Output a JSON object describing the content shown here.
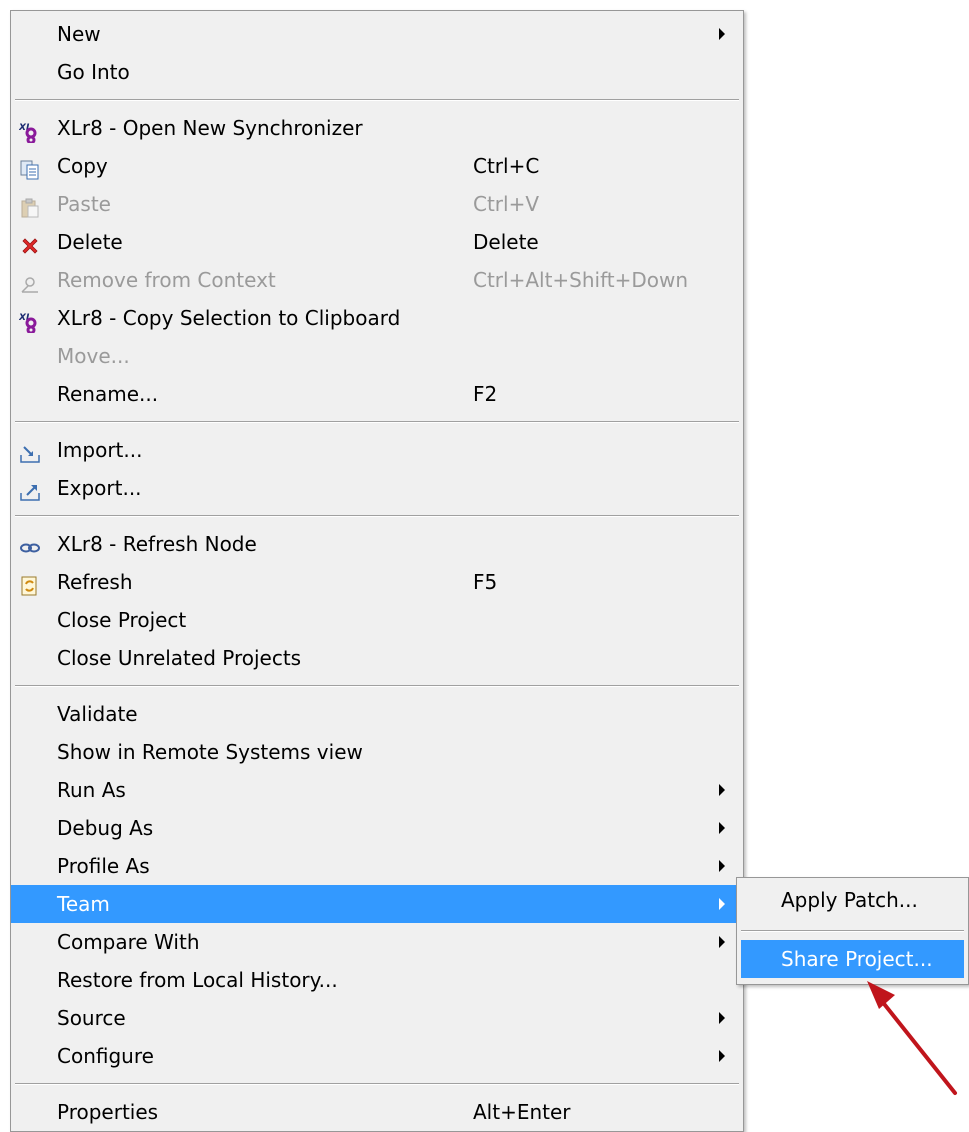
{
  "menu": {
    "items": [
      {
        "type": "item",
        "name": "menu-item-new",
        "label": "New",
        "submenu": true
      },
      {
        "type": "item",
        "name": "menu-item-go-into",
        "label": "Go Into"
      },
      {
        "type": "separator"
      },
      {
        "type": "item",
        "name": "menu-item-xlr8-open-new-synchronizer",
        "label": "XLr8 - Open New Synchronizer",
        "icon": "xlr8-icon"
      },
      {
        "type": "item",
        "name": "menu-item-copy",
        "label": "Copy",
        "shortcut": "Ctrl+C",
        "icon": "copy-icon"
      },
      {
        "type": "item",
        "name": "menu-item-paste",
        "label": "Paste",
        "shortcut": "Ctrl+V",
        "icon": "paste-icon",
        "disabled": true
      },
      {
        "type": "item",
        "name": "menu-item-delete",
        "label": "Delete",
        "shortcut": "Delete",
        "icon": "delete-icon"
      },
      {
        "type": "item",
        "name": "menu-item-remove-from-context",
        "label": "Remove from Context",
        "shortcut": "Ctrl+Alt+Shift+Down",
        "icon": "remove-context-icon",
        "disabled": true
      },
      {
        "type": "item",
        "name": "menu-item-xlr8-copy-selection",
        "label": "XLr8 - Copy Selection to Clipboard",
        "icon": "xlr8-icon"
      },
      {
        "type": "item",
        "name": "menu-item-move",
        "label": "Move...",
        "disabled": true
      },
      {
        "type": "item",
        "name": "menu-item-rename",
        "label": "Rename...",
        "shortcut": "F2"
      },
      {
        "type": "separator"
      },
      {
        "type": "item",
        "name": "menu-item-import",
        "label": "Import...",
        "icon": "import-icon"
      },
      {
        "type": "item",
        "name": "menu-item-export",
        "label": "Export...",
        "icon": "export-icon"
      },
      {
        "type": "separator"
      },
      {
        "type": "item",
        "name": "menu-item-xlr8-refresh-node",
        "label": "XLr8 - Refresh Node",
        "icon": "link-icon"
      },
      {
        "type": "item",
        "name": "menu-item-refresh",
        "label": "Refresh",
        "shortcut": "F5",
        "icon": "refresh-icon"
      },
      {
        "type": "item",
        "name": "menu-item-close-project",
        "label": "Close Project"
      },
      {
        "type": "item",
        "name": "menu-item-close-unrelated-projects",
        "label": "Close Unrelated Projects"
      },
      {
        "type": "separator"
      },
      {
        "type": "item",
        "name": "menu-item-validate",
        "label": "Validate"
      },
      {
        "type": "item",
        "name": "menu-item-show-in-remote-systems",
        "label": "Show in Remote Systems view"
      },
      {
        "type": "item",
        "name": "menu-item-run-as",
        "label": "Run As",
        "submenu": true
      },
      {
        "type": "item",
        "name": "menu-item-debug-as",
        "label": "Debug As",
        "submenu": true
      },
      {
        "type": "item",
        "name": "menu-item-profile-as",
        "label": "Profile As",
        "submenu": true
      },
      {
        "type": "item",
        "name": "menu-item-team",
        "label": "Team",
        "submenu": true,
        "highlighted": true
      },
      {
        "type": "item",
        "name": "menu-item-compare-with",
        "label": "Compare With",
        "submenu": true
      },
      {
        "type": "item",
        "name": "menu-item-restore-from-local-history",
        "label": "Restore from Local History..."
      },
      {
        "type": "item",
        "name": "menu-item-source",
        "label": "Source",
        "submenu": true
      },
      {
        "type": "item",
        "name": "menu-item-configure",
        "label": "Configure",
        "submenu": true
      },
      {
        "type": "separator"
      },
      {
        "type": "item",
        "name": "menu-item-properties",
        "label": "Properties",
        "shortcut": "Alt+Enter"
      }
    ]
  },
  "team_submenu": {
    "apply_patch_label": "Apply Patch...",
    "share_project_label": "Share Project..."
  },
  "colors": {
    "highlight": "#3399ff",
    "annotation_arrow": "#c0151c"
  }
}
